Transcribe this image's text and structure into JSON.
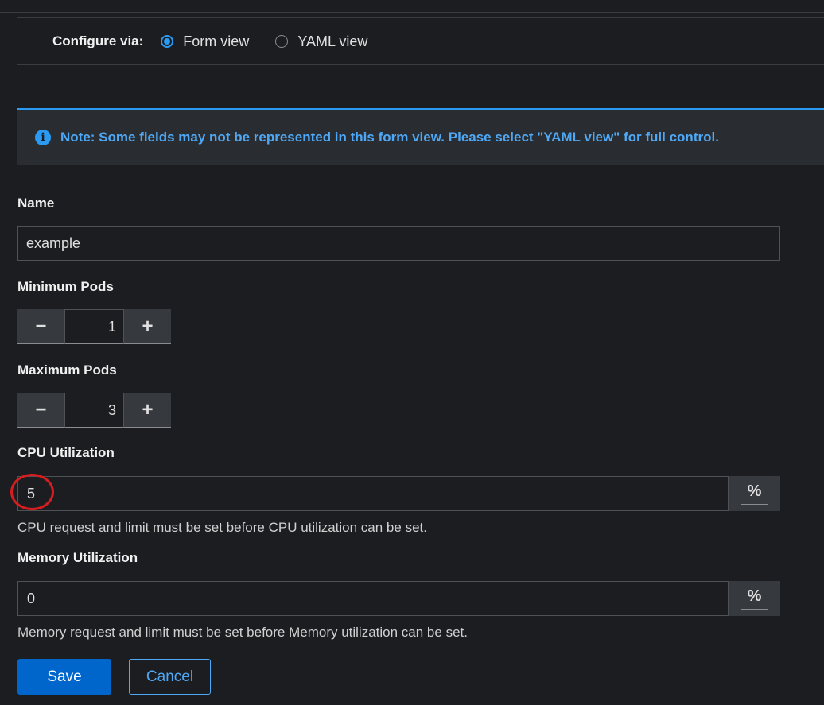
{
  "configure": {
    "label": "Configure via:",
    "options": [
      {
        "label": "Form view",
        "selected": true
      },
      {
        "label": "YAML view",
        "selected": false
      }
    ]
  },
  "alert": {
    "icon": "info-icon",
    "text": "Note: Some fields may not be represented in this form view. Please select \"YAML view\" for full control."
  },
  "form": {
    "name": {
      "label": "Name",
      "value": "example"
    },
    "min_pods": {
      "label": "Minimum Pods",
      "value": "1",
      "minus": "−",
      "plus": "+"
    },
    "max_pods": {
      "label": "Maximum Pods",
      "value": "3",
      "minus": "−",
      "plus": "+"
    },
    "cpu": {
      "label": "CPU Utilization",
      "value": "5",
      "unit": "%",
      "helper": "CPU request and limit must be set before CPU utilization can be set."
    },
    "memory": {
      "label": "Memory Utilization",
      "value": "0",
      "unit": "%",
      "helper": "Memory request and limit must be set before Memory utilization can be set."
    }
  },
  "actions": {
    "save": "Save",
    "cancel": "Cancel"
  },
  "colors": {
    "accent": "#0066cc",
    "link": "#4fa8f5",
    "highlight": "#d71d20"
  }
}
